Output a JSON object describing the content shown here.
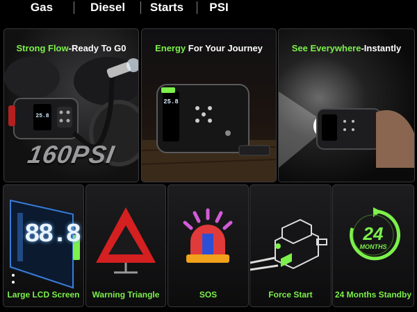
{
  "tabs": [
    {
      "label": "Gas"
    },
    {
      "label": "Diesel"
    },
    {
      "label": "Starts"
    },
    {
      "label": "PSI"
    }
  ],
  "features": [
    {
      "highlight": "Strong Flow",
      "rest": "-Ready To G0",
      "overlay": "160PSI",
      "display": "25.8"
    },
    {
      "highlight": "Energy",
      "rest": " For Your Journey",
      "display": "25.8"
    },
    {
      "highlight": "See Everywhere",
      "rest": "-Instantly"
    }
  ],
  "icons": [
    {
      "label": "Large LCD Screen",
      "icon": "lcd-screen-icon",
      "display": "88.8"
    },
    {
      "label": "Warning Triangle",
      "icon": "warning-triangle-icon"
    },
    {
      "label": "SOS",
      "icon": "sos-beacon-icon"
    },
    {
      "label": "Force Start",
      "icon": "force-start-icon"
    },
    {
      "label": "24 Months Standby",
      "icon": "standby-24-months-icon",
      "badge_number": "24",
      "badge_text": "MONTHS"
    }
  ],
  "colors": {
    "accent": "#7cf04b",
    "card_border": "#3a3a3c"
  }
}
